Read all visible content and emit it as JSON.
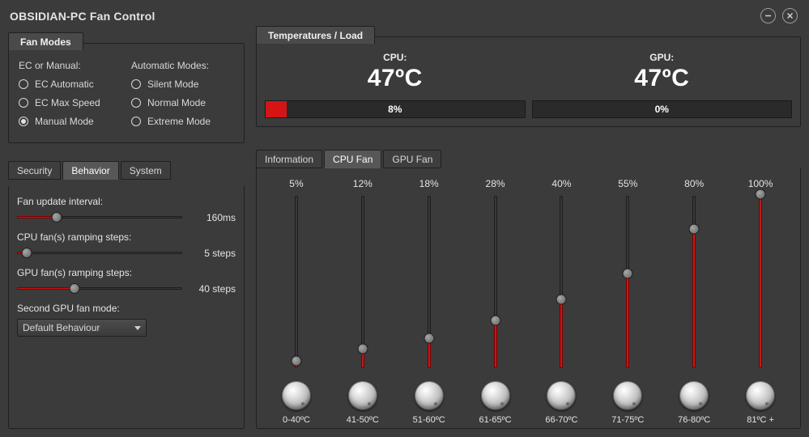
{
  "title": "OBSIDIAN-PC Fan Control",
  "accent": "#c11919",
  "fan_modes": {
    "tab_label": "Fan Modes",
    "left_heading": "EC or Manual:",
    "right_heading": "Automatic Modes:",
    "ec": [
      {
        "label": "EC Automatic",
        "selected": false
      },
      {
        "label": "EC Max Speed",
        "selected": false
      },
      {
        "label": "Manual Mode",
        "selected": true
      }
    ],
    "auto": [
      {
        "label": "Silent Mode",
        "selected": false
      },
      {
        "label": "Normal Mode",
        "selected": false
      },
      {
        "label": "Extreme Mode",
        "selected": false
      }
    ]
  },
  "behavior_tabs": {
    "items": [
      "Security",
      "Behavior",
      "System"
    ],
    "active": "Behavior"
  },
  "behavior": {
    "update_interval": {
      "label": "Fan update interval:",
      "value_text": "160ms",
      "pct": 24
    },
    "cpu_ramp": {
      "label": "CPU fan(s) ramping steps:",
      "value_text": "5 steps",
      "pct": 6
    },
    "gpu_ramp": {
      "label": "GPU fan(s) ramping steps:",
      "value_text": "40 steps",
      "pct": 35
    },
    "second_gpu": {
      "label": "Second GPU fan mode:",
      "value": "Default Behaviour"
    }
  },
  "temps": {
    "tab_label": "Temperatures / Load",
    "cpu": {
      "label": "CPU:",
      "value": "47ºC",
      "load_pct": 8,
      "load_text": "8%"
    },
    "gpu": {
      "label": "GPU:",
      "value": "47ºC",
      "load_pct": 0,
      "load_text": "0%"
    }
  },
  "fan_tabs": {
    "items": [
      "Information",
      "CPU Fan",
      "GPU Fan"
    ],
    "active": "CPU Fan"
  },
  "fan_curve": [
    {
      "pct": 5,
      "range": "0-40ºC"
    },
    {
      "pct": 12,
      "range": "41-50ºC"
    },
    {
      "pct": 18,
      "range": "51-60ºC"
    },
    {
      "pct": 28,
      "range": "61-65ºC"
    },
    {
      "pct": 40,
      "range": "66-70ºC"
    },
    {
      "pct": 55,
      "range": "71-75ºC"
    },
    {
      "pct": 80,
      "range": "76-80ºC"
    },
    {
      "pct": 100,
      "range": "81ºC +"
    }
  ]
}
